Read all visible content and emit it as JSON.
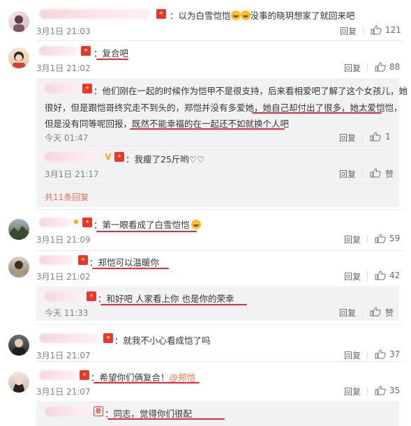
{
  "comments": [
    {
      "text_pre": "以为白雪恺恺",
      "text_post": "没事的晓玥想家了就回来吧",
      "time": "3月1日 21:03",
      "reply_label": "回复",
      "likes": "121"
    },
    {
      "text": "复合吧",
      "time": "3月1日 21:02",
      "reply_label": "回复",
      "likes": "88",
      "replies": [
        {
          "line1": "他们刚在一起的时候作为恺甲不是很支持，后来看相爱吧了解了这个女孩儿，她",
          "line2_pre": "很好，但是跟恺哥终究走不到头的，郑恺并没有多爱她，",
          "line2_hl": "她自己却付出了很多，她太爱恺恺",
          "line2_post": "，",
          "line3_pre": "但是没有同等呢回报，",
          "line3_hl": "既然不能幸福的在一起还不如就换个人吧",
          "time": "今天 01:47",
          "reply_label": "回复",
          "likes": "1"
        },
        {
          "text": "我瘦了25斤哟♡♡",
          "time": "3月1日 21:17",
          "reply_label": "回复",
          "like_label": "赞"
        }
      ],
      "more_label": "共11条回复"
    },
    {
      "text": "第一眼看成了白雪恺恺",
      "time": "3月1日 21:09",
      "reply_label": "回复",
      "likes": "59"
    },
    {
      "text": "郑恺可以温暖你",
      "time": "3月1日 21:02",
      "reply_label": "回复",
      "likes": "42",
      "replies": [
        {
          "text": "和好吧  人家看上你  也是你的荣幸",
          "time": "今天 11:33",
          "reply_label": "回复",
          "like_label": "赞"
        }
      ]
    },
    {
      "text": "就我不小心看成恺了吗",
      "time": "3月1日 21:07",
      "reply_label": "回复",
      "likes": "37"
    },
    {
      "text_pre": "希望你们俩复合！",
      "mention": "@郑恺",
      "time": "3月1日 21:07",
      "reply_label": "回复",
      "likes": "35",
      "replies": [
        {
          "text": "同志，觉得你们很配"
        }
      ]
    }
  ],
  "badge_glyph": "V",
  "colors": {
    "accent": "#e8283c",
    "more": "#eb7350",
    "nested_bg": "#f2f2f5"
  }
}
